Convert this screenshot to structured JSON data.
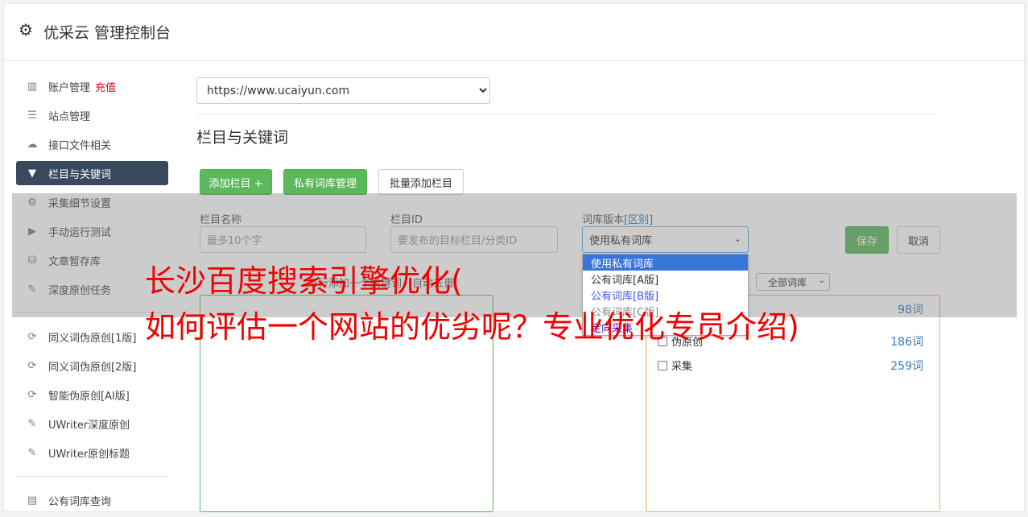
{
  "header": {
    "icon": "gear-icon",
    "title": "优采云 管理控制台"
  },
  "sidebar": {
    "items": [
      {
        "label": "账户管理",
        "icon": "bar-chart-icon",
        "badge": "充值"
      },
      {
        "label": "站点管理",
        "icon": "server-icon"
      },
      {
        "label": "接口文件相关",
        "icon": "cloud-upload-icon"
      },
      {
        "label": "栏目与关键词",
        "icon": "filter-icon",
        "active": true
      },
      {
        "label": "采集细节设置",
        "icon": "gears-icon"
      },
      {
        "label": "手动运行测试",
        "icon": "play-circle-icon"
      },
      {
        "label": "文章暂存库",
        "icon": "database-icon"
      },
      {
        "label": "深度原创任务",
        "icon": "edit-icon"
      }
    ],
    "items2": [
      {
        "label": "同义词伪原创[1版]",
        "icon": "refresh-icon"
      },
      {
        "label": "同义词伪原创[2版]",
        "icon": "refresh-icon"
      },
      {
        "label": "智能伪原创[AI版]",
        "icon": "refresh-icon"
      },
      {
        "label": "UWriter深度原创",
        "icon": "edit-icon"
      },
      {
        "label": "UWriter原创标题",
        "icon": "edit-icon"
      }
    ],
    "items3": [
      {
        "label": "公有词库查询",
        "icon": "book-icon"
      }
    ]
  },
  "main": {
    "site_select": "https://www.ucaiyun.com",
    "section_title": "栏目与关键词",
    "buttons": {
      "add_column": "添加栏目 +",
      "private_lib": "私有词库管理",
      "batch_add": "批量添加栏目"
    },
    "form": {
      "name_label": "栏目名称",
      "name_placeholder": "最多10个字",
      "id_label": "栏目ID",
      "id_placeholder": "要发布的目标栏目/分类ID",
      "version_label": "词库版本",
      "version_link": "[区别]",
      "version_value": "使用私有词库",
      "save": "保存",
      "cancel": "取消"
    },
    "dropdown_options": [
      "使用私有词库",
      "公有词库[A版]",
      "公有词库[B版]",
      "公有词库[C版]",
      "定向采集"
    ],
    "ghost_text": "每行添加一个关键词，自动去重",
    "lib_filter": "全部词库",
    "libs": [
      {
        "name": "",
        "count": "98词"
      },
      {
        "name": "伪原创",
        "count": "186词"
      },
      {
        "name": "采集",
        "count": "259词"
      }
    ]
  },
  "overlay": {
    "line1": "长沙百度搜索引擎优化(",
    "line2": "如何评估一个网站的优劣呢？专业优化专员介绍)"
  },
  "colors": {
    "accent": "#5cb85c",
    "active_nav": "#3a4a5e",
    "headline": "#f00000",
    "link": "#337ab7"
  }
}
